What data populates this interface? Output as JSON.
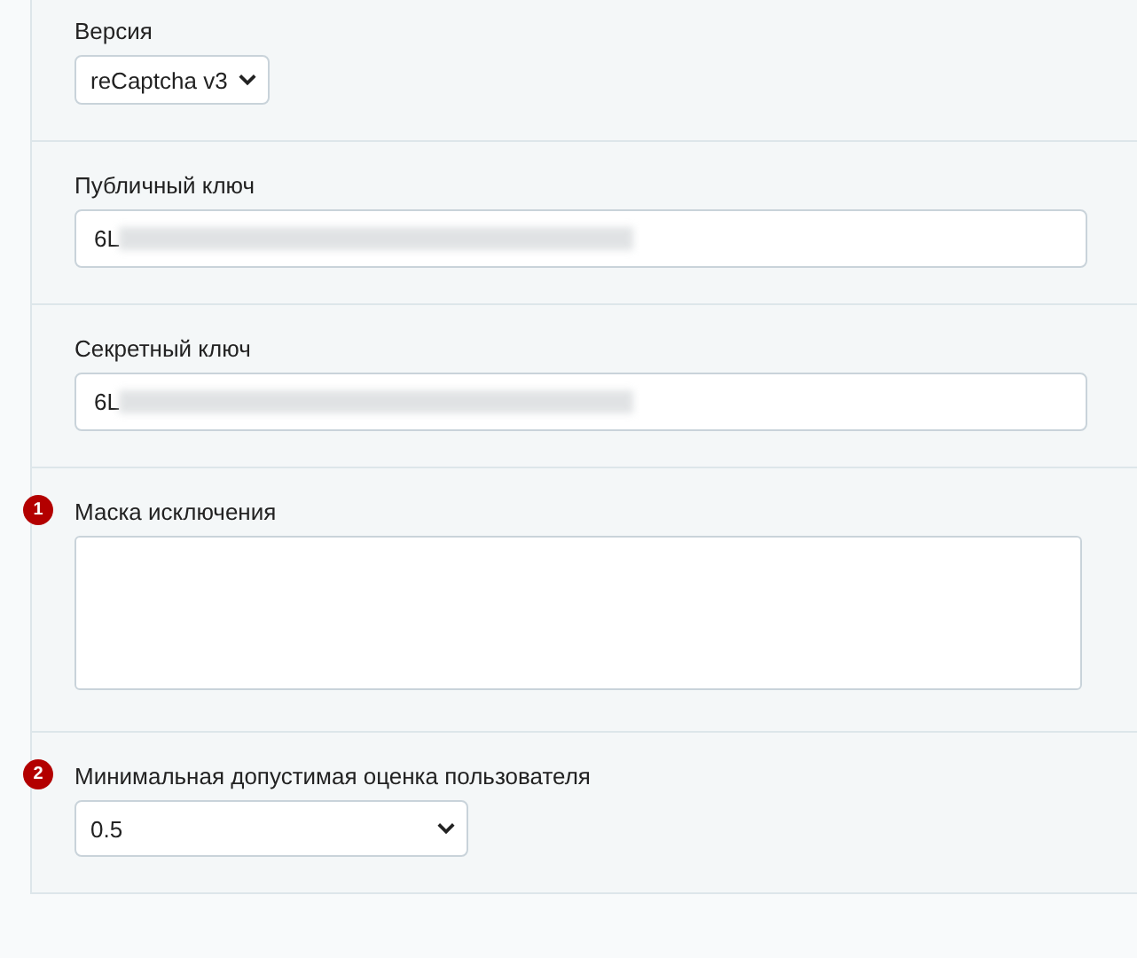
{
  "fields": [
    {
      "kind": "select",
      "label": "Версия",
      "value": "reCaptcha v3"
    },
    {
      "kind": "input",
      "label": "Публичный ключ",
      "value": "6L",
      "redacted": true
    },
    {
      "kind": "input",
      "label": "Секретный ключ",
      "value": "6L",
      "redacted": true
    },
    {
      "kind": "textarea",
      "label": "Маска исключения",
      "badge": "1"
    },
    {
      "kind": "wide-select",
      "label": "Минимальная допустимая оценка пользователя",
      "value": "0.5",
      "badge": "2"
    }
  ]
}
